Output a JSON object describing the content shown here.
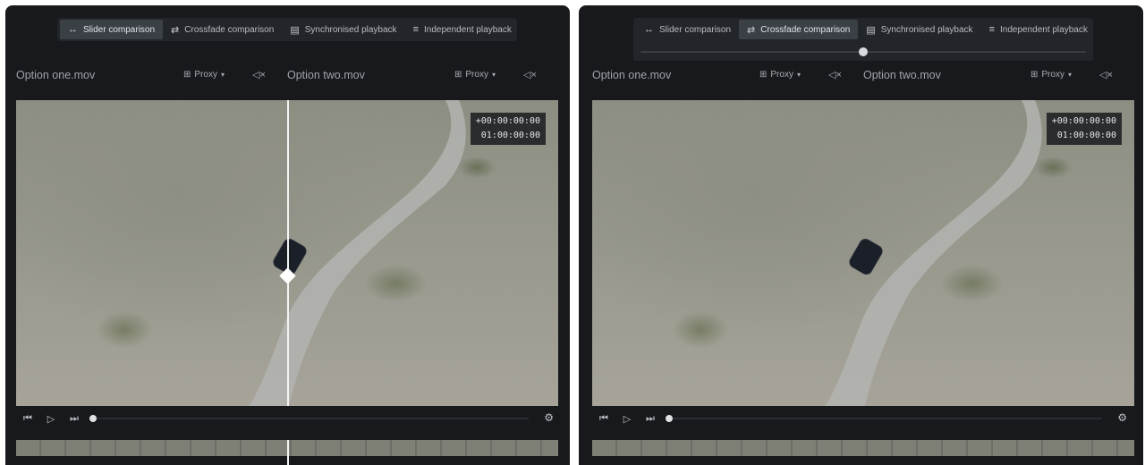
{
  "tabs": [
    {
      "label": "Slider comparison",
      "icon": "↔"
    },
    {
      "label": "Crossfade comparison",
      "icon": "⇄"
    },
    {
      "label": "Synchronised playback",
      "icon": "▤"
    },
    {
      "label": "Independent playback",
      "icon": "≡"
    }
  ],
  "left": {
    "active_tab": "Slider comparison",
    "file_one": "Option one.mov",
    "file_two": "Option two.mov",
    "proxy_label": "Proxy",
    "timecode_offset": "+00:00:00:00",
    "timecode": "01:00:00:00"
  },
  "right": {
    "active_tab": "Crossfade comparison",
    "file_one": "Option one.mov",
    "file_two": "Option two.mov",
    "proxy_label": "Proxy",
    "timecode_offset": "+00:00:00:00",
    "timecode": "01:00:00:00",
    "crossfade_position": 0.5
  },
  "icons": {
    "mute": "🔇",
    "skip_back": "⏮",
    "play": "▷",
    "skip_forward": "⏭",
    "gear": "⚙",
    "caret": "▾"
  },
  "colors": {
    "panel_bg": "#17191c",
    "tab_bar_bg": "#22252a",
    "tab_active_bg": "#3b3f46",
    "divider": "#f3f3f3"
  }
}
